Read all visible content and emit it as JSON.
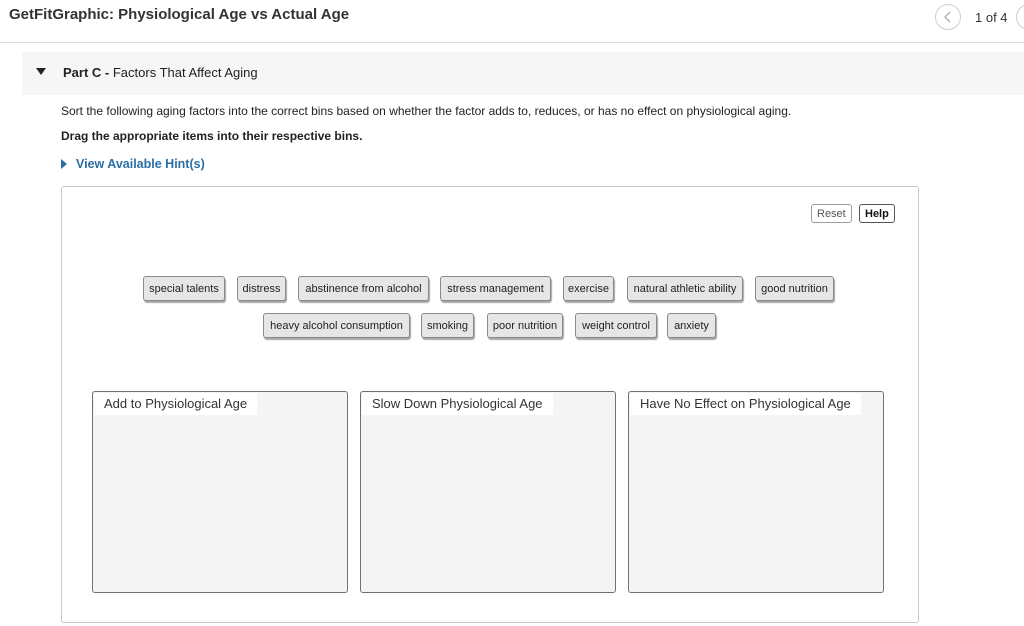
{
  "header": {
    "title": "GetFitGraphic: Physiological Age vs Actual Age",
    "page_count": "1 of 4"
  },
  "part": {
    "label": "Part C -",
    "title": "Factors That Affect Aging"
  },
  "instructions": "Sort the following aging factors into the correct bins based on whether the factor adds to, reduces, or has no effect on physiological aging.",
  "instructions_bold": "Drag the appropriate items into their respective bins.",
  "hints_link": "View Available Hint(s)",
  "workspace": {
    "reset_label": "Reset",
    "help_label": "Help",
    "items": [
      "special talents",
      "distress",
      "abstinence from alcohol",
      "stress management",
      "exercise",
      "natural athletic ability",
      "good nutrition",
      "heavy alcohol consumption",
      "smoking",
      "poor nutrition",
      "weight control",
      "anxiety"
    ],
    "bins": [
      "Add to Physiological Age",
      "Slow Down Physiological Age",
      "Have No Effect on Physiological Age"
    ]
  },
  "colors": {
    "link": "#2b6ea3",
    "item_bg": "#e6e6e6",
    "bin_bg": "#f4f4f4",
    "header_bg": "#f6f6f6"
  },
  "icons": {
    "nav_prev": "chevron-left-icon",
    "part_toggle": "caret-down-icon",
    "hints_toggle": "caret-right-icon"
  }
}
